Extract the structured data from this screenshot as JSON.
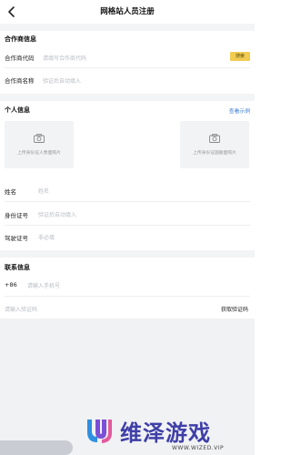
{
  "nav": {
    "title": "网格站人员注册"
  },
  "partner": {
    "title": "合作商信息",
    "code_label": "合作商代码",
    "code_placeholder": "请填写合作商代码",
    "button": "搜索",
    "name_label": "合作商名称",
    "name_placeholder": "验证后自动填入"
  },
  "personal": {
    "title": "个人信息",
    "example_link": "查看示例",
    "id_front": "上传身份证人像面照片",
    "id_back": "上传身份证国徽面照片",
    "name_label": "姓名",
    "name_placeholder": "姓名",
    "id_label": "身份证号",
    "id_placeholder": "验证后自动填入",
    "license_label": "驾驶证号",
    "license_placeholder": "非必填"
  },
  "contact": {
    "title": "联系信息",
    "country_code": "+86",
    "phone_placeholder": "请输入手机号",
    "code_placeholder": "请输入验证码",
    "get_code": "获取验证码"
  },
  "watermark": {
    "name": "维泽游戏",
    "url": "WWW.WIZED.VIP"
  }
}
